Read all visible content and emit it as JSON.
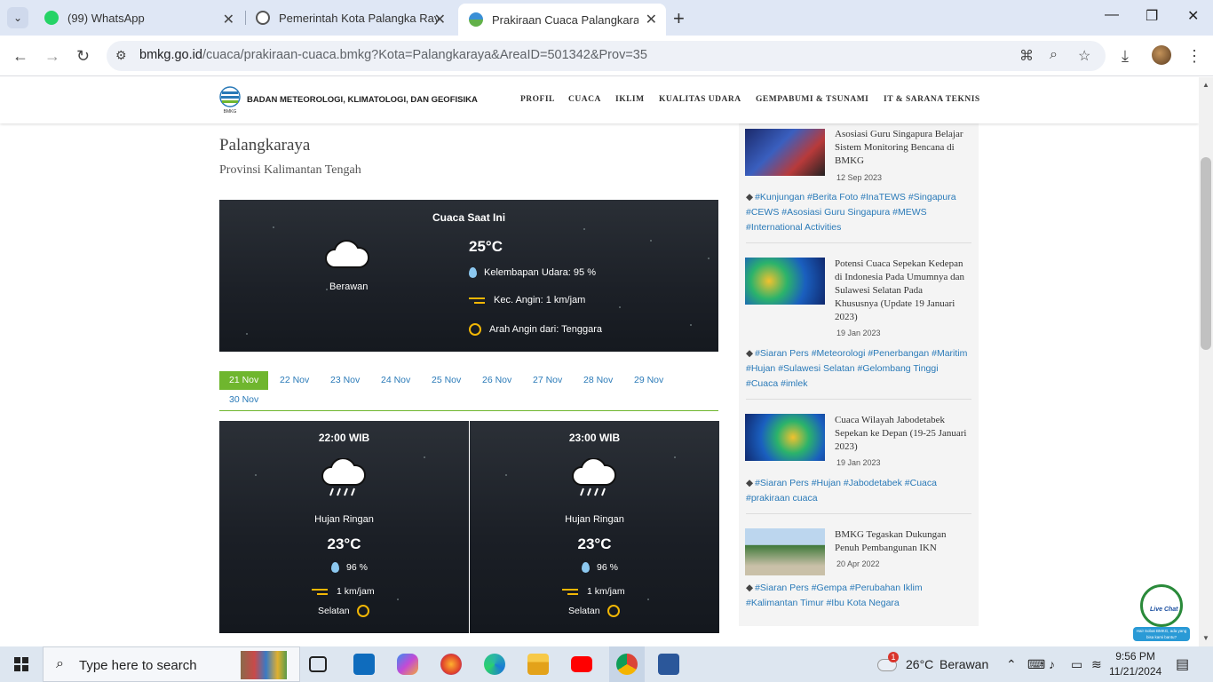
{
  "browser": {
    "tabs": [
      {
        "title": "(99) WhatsApp",
        "active": false
      },
      {
        "title": "Pemerintah Kota Palangka Raya",
        "active": false
      },
      {
        "title": "Prakiraan Cuaca Palangkaraya -",
        "active": true
      }
    ],
    "url_host": "bmkg.go.id",
    "url_path": "/cuaca/prakiraan-cuaca.bmkg?Kota=Palangkaraya&AreaID=501342&Prov=35"
  },
  "site": {
    "logo_label": "BMKG",
    "org_name": "BADAN METEOROLOGI, KLIMATOLOGI, DAN GEOFISIKA",
    "nav": [
      "PROFIL",
      "CUACA",
      "IKLIM",
      "KUALITAS UDARA",
      "GEMPABUMI & TSUNAMI",
      "IT & SARANA TEKNIS"
    ]
  },
  "location": {
    "city": "Palangkaraya",
    "province": "Provinsi Kalimantan Tengah"
  },
  "current": {
    "title": "Cuaca Saat Ini",
    "condition": "Berawan",
    "temperature": "25°C",
    "humidity": "Kelembapan Udara: 95 %",
    "wind_speed": "Kec. Angin: 1 km/jam",
    "wind_dir": "Arah Angin dari: Tenggara"
  },
  "dates": [
    "21 Nov",
    "22 Nov",
    "23 Nov",
    "24 Nov",
    "25 Nov",
    "26 Nov",
    "27 Nov",
    "28 Nov",
    "29 Nov",
    "30 Nov"
  ],
  "active_date": "21 Nov",
  "forecasts": [
    {
      "time": "22:00 WIB",
      "condition": "Hujan Ringan",
      "temperature": "23°C",
      "humidity": "96 %",
      "wind": "1 km/jam",
      "direction": "Selatan"
    },
    {
      "time": "23:00 WIB",
      "condition": "Hujan Ringan",
      "temperature": "23°C",
      "humidity": "96 %",
      "wind": "1 km/jam",
      "direction": "Selatan"
    }
  ],
  "articles": [
    {
      "title": "Asosiasi Guru Singapura Belajar Sistem Monitoring Bencana di BMKG",
      "date": "12 Sep 2023",
      "tags": "#Kunjungan #Berita Foto #InaTEWS #Singapura #CEWS #Asosiasi Guru Singapura #MEWS #International Activities"
    },
    {
      "title": "Potensi Cuaca Sepekan Kedepan di Indonesia Pada Umumnya dan Sulawesi Selatan Pada Khususnya (Update 19 Januari 2023)",
      "date": "19 Jan 2023",
      "tags": "#Siaran Pers #Meteorologi #Penerbangan #Maritim #Hujan #Sulawesi Selatan #Gelombang Tinggi #Cuaca #imlek"
    },
    {
      "title": "Cuaca Wilayah Jabodetabek Sepekan ke Depan (19-25 Januari 2023)",
      "date": "19 Jan 2023",
      "tags": "#Siaran Pers #Hujan #Jabodetabek #Cuaca #prakiraan cuaca"
    },
    {
      "title": "BMKG Tegaskan Dukungan Penuh Pembangunan IKN",
      "date": "20 Apr 2022",
      "tags": "#Siaran Pers #Gempa #Perubahan Iklim #Kalimantan Timur #Ibu Kota Negara"
    }
  ],
  "livechat": {
    "label": "Live Chat",
    "bubble": "Hai! Sobat BMKG, ada yang bisa kami bantu?"
  },
  "taskbar": {
    "search_placeholder": "Type here to search",
    "weather_temp": "26°C",
    "weather_cond": "Berawan",
    "weather_badge": "1",
    "time": "9:56 PM",
    "date": "11/21/2024"
  }
}
